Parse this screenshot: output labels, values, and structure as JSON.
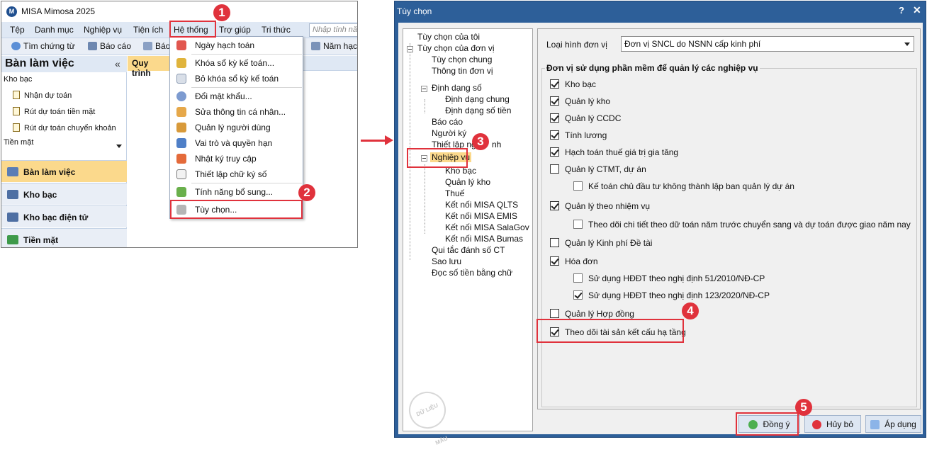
{
  "app": {
    "title": "MISA Mimosa 2025",
    "logo": "M",
    "menu": [
      "Tệp",
      "Danh mục",
      "Nghiệp vụ",
      "Tiện ích",
      "Hệ thống",
      "Trợ giúp",
      "Tri thức"
    ],
    "search_placeholder": "Nhập tính năng",
    "toolbar": [
      "Tìm chứng từ",
      "Báo cáo",
      "Báo",
      "Năm hạch"
    ],
    "sidebar": {
      "title": "Bàn làm việc",
      "collapse": "«",
      "section1": "Kho bạc",
      "links": [
        "Nhận dự toán",
        "Rút dự toán tiền mặt",
        "Rút dự toán chuyển khoản"
      ],
      "section2": "Tiền mặt",
      "nav": [
        "Bàn làm việc",
        "Kho bạc",
        "Kho bạc điện tử",
        "Tiền mặt"
      ]
    },
    "tab": "Quy trình",
    "dropdown": [
      "Ngày hạch toán",
      "Khóa sổ kỳ kế toán...",
      "Bỏ khóa sổ kỳ kế toán",
      "Đổi mật khẩu...",
      "Sửa thông tin cá nhân...",
      "Quản lý người dùng",
      "Vai trò và quyền hạn",
      "Nhật ký truy cập",
      "Thiết lập chữ ký số",
      "Tính năng bổ sung...",
      "Tùy chọn..."
    ]
  },
  "badges": [
    "1",
    "2",
    "3",
    "4",
    "5"
  ],
  "dialog": {
    "title": "Tùy chọn",
    "help": "?",
    "close": "✕",
    "tree": [
      "Tùy chọn của tôi",
      "Tùy chọn của đơn vị",
      "Tùy chọn chung",
      "Thông tin đơn vị",
      "Định dạng số",
      "Định dạng chung",
      "Định dạng số tiền",
      "Báo cáo",
      "Người ký",
      "Thiết lập ng",
      "nh",
      "Nghiệp vụ",
      "Kho bạc",
      "Quản lý kho",
      "Thuế",
      "Kết nối MISA QLTS",
      "Kết nối MISA EMIS",
      "Kết nối MISA SalaGov",
      "Kết nối MISA Bumas",
      "Qui tắc đánh số CT",
      "Sao lưu",
      "Đọc số tiền bằng chữ"
    ],
    "stamp": "DỮ LIỆU MẪU",
    "unit_label": "Loại hình đơn vị",
    "unit_value": "Đơn vị SNCL do NSNN cấp kinh phí",
    "group_title": "Đơn vị sử dụng phần mềm để quản lý các nghiệp vụ",
    "options": [
      {
        "label": "Kho bạc",
        "checked": true
      },
      {
        "label": "Quản lý kho",
        "checked": true
      },
      {
        "label": "Quản lý CCDC",
        "checked": true
      },
      {
        "label": "Tính lương",
        "checked": true
      },
      {
        "label": "Hạch toán thuế giá trị gia tăng",
        "checked": true
      },
      {
        "label": "Quản lý CTMT, dự án",
        "checked": false
      },
      {
        "label": "Kế toán chủ đầu tư không thành lập ban quản lý dự án",
        "checked": false
      },
      {
        "label": "Quản lý theo nhiệm vụ",
        "checked": true
      },
      {
        "label": "Theo dõi chi tiết theo dữ toán năm trước chuyển sang và dự toán được giao năm nay",
        "checked": false
      },
      {
        "label": "Quản lý Kinh phí Đề tài",
        "checked": false
      },
      {
        "label": "Hóa đơn",
        "checked": true
      },
      {
        "label": "Sử dụng HĐĐT theo nghị định 51/2010/NĐ-CP",
        "checked": false
      },
      {
        "label": "Sử dụng HĐĐT theo nghị định 123/2020/NĐ-CP",
        "checked": true
      },
      {
        "label": "Quản lý Hợp đồng",
        "checked": false
      },
      {
        "label": "Theo dõi tài sản kết cấu hạ tầng",
        "checked": true
      }
    ],
    "buttons": {
      "ok": "Đồng ý",
      "cancel": "Hủy bỏ",
      "apply": "Áp dụng"
    }
  }
}
